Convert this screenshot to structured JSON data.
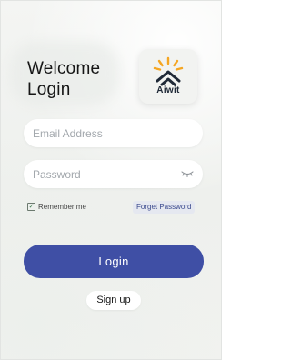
{
  "header": {
    "title_line1": "Welcome",
    "title_line2": "Login",
    "logo_text": "Aiwit",
    "logo_icon": "aiwit-house-sunburst-icon"
  },
  "form": {
    "email_placeholder": "Email Address",
    "password_placeholder": "Password",
    "eye_icon": "eye-closed-icon",
    "remember_label": "Remember me",
    "remember_checked": true,
    "forget_label": "Forget Password",
    "login_label": "Login",
    "signup_label": "Sign up"
  },
  "colors": {
    "primary_button": "#3f4fa5",
    "link_text": "#3d4c8f",
    "logo_orange": "#f5a623",
    "logo_navy": "#1f2937"
  }
}
